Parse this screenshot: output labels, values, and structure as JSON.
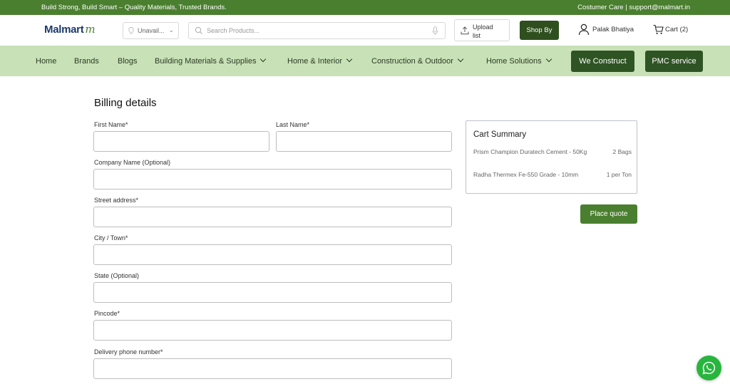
{
  "topbar": {
    "tagline": "Build Strong, Build Smart – Quality Materials, Trusted Brands.",
    "care": "Costumer Care | support@malmart.in"
  },
  "header": {
    "logo": "Malmart",
    "logo_mark": "m",
    "location": "Unavail...",
    "search_placeholder": "Search Products...",
    "upload_line1": "Upload",
    "upload_line2": "list",
    "shop_by": "Shop By",
    "user": "Palak Bhatiya",
    "cart": "Cart (2)"
  },
  "nav": {
    "items": [
      "Home",
      "Brands",
      "Blogs",
      "Building Materials & Supplies",
      "Home & Interior",
      "Construction & Outdoor",
      "Home Solutions"
    ],
    "we_construct": "We Construct",
    "pmc": "PMC service"
  },
  "billing": {
    "title": "Billing details",
    "first_name": "First Name*",
    "last_name": "Last Name*",
    "company": "Company Name (Optional)",
    "street": "Street address*",
    "city": "City / Town*",
    "state": "State (Optional)",
    "pincode": "Pincode*",
    "phone": "Delivery phone number*"
  },
  "summary": {
    "title": "Cart Summary",
    "items": [
      {
        "name": "Prism Champion Duratech Cement - 50Kg",
        "qty": "2 Bags"
      },
      {
        "name": "Radha Thermex Fe-550 Grade - 10mm",
        "qty": "1 per Ton"
      }
    ],
    "place_quote": "Place quote"
  },
  "colors": {
    "brand_green": "#4a7f2f",
    "dark_green": "#2f5424",
    "nav_bg": "#c8e1b7",
    "whatsapp": "#28b53e"
  }
}
